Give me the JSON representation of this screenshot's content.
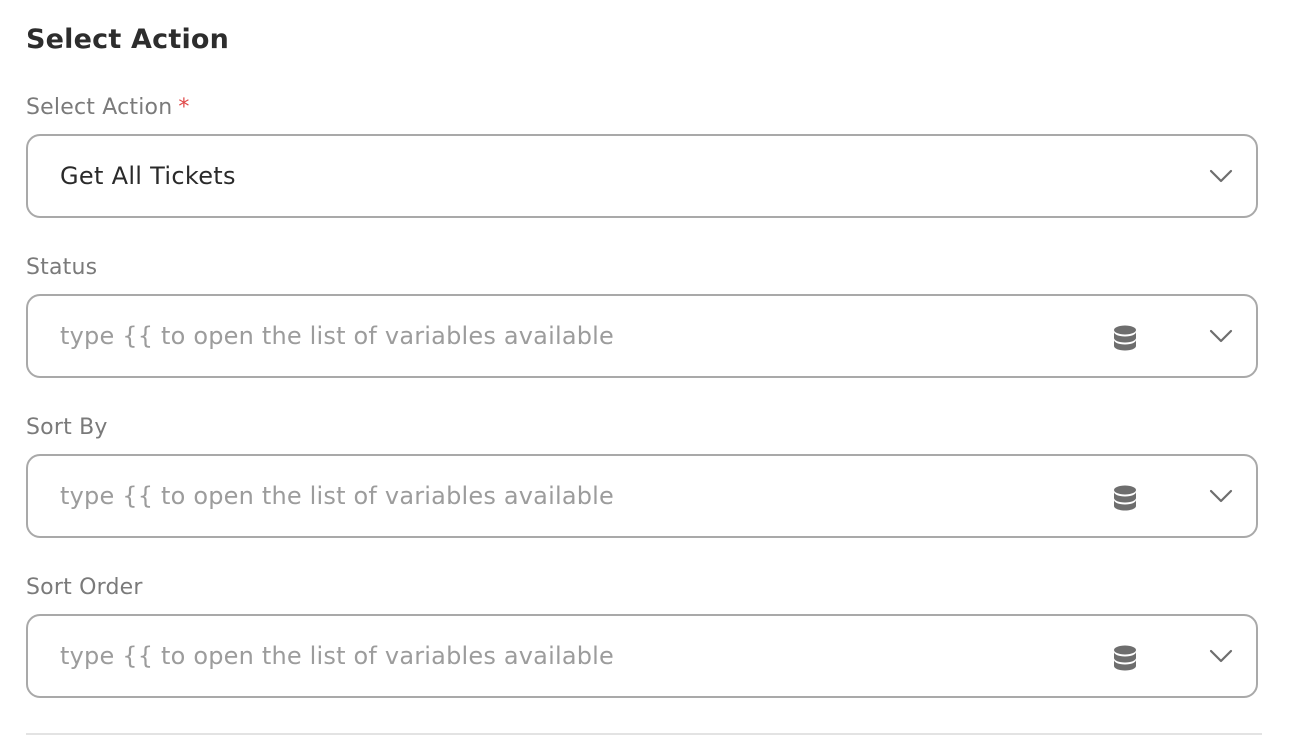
{
  "section": {
    "title": "Select Action"
  },
  "fields": {
    "action": {
      "label": "Select Action",
      "required_mark": "*",
      "value": "Get All Tickets"
    },
    "status": {
      "label": "Status",
      "placeholder": "type {{ to open the list of variables available"
    },
    "sort_by": {
      "label": "Sort By",
      "placeholder": "type {{ to open the list of variables available"
    },
    "sort_order": {
      "label": "Sort Order",
      "placeholder": "type {{ to open the list of variables available"
    }
  },
  "icons": {
    "dropdown": "chevron-down-icon",
    "variables": "database-icon"
  },
  "colors": {
    "required": "#e04848",
    "border": "#a9a9a9",
    "label": "#7a7a7a",
    "placeholder": "#9c9c9c"
  }
}
